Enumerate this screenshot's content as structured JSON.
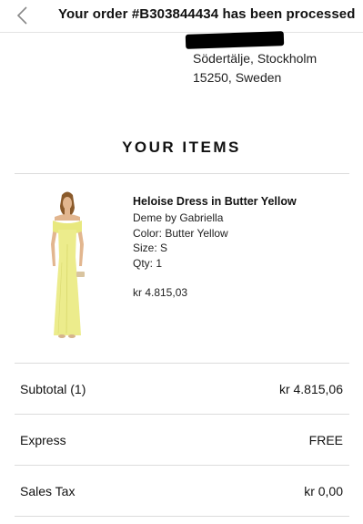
{
  "header": {
    "title": "Your order #B303844434 has been processed",
    "back_icon": "chevron-left-icon"
  },
  "shipping_address": {
    "line_1": "Södertälje, Stockholm",
    "line_2": "15250, Sweden"
  },
  "items_section": {
    "title": "YOUR ITEMS"
  },
  "items": [
    {
      "name": "Heloise Dress in Butter Yellow",
      "brand": "Deme by Gabriella",
      "color": "Color: Butter Yellow",
      "size": "Size: S",
      "qty": "Qty: 1",
      "price": "kr 4.815,03"
    }
  ],
  "summary": {
    "subtotal_label": "Subtotal (1)",
    "subtotal_value": "kr 4.815,06",
    "shipping_label": "Express",
    "shipping_value": "FREE",
    "tax_label": "Sales Tax",
    "tax_value": "kr 0,00"
  },
  "colors": {
    "text": "#111111",
    "divider": "#dcdcdc",
    "dress": "#ecec8c"
  }
}
